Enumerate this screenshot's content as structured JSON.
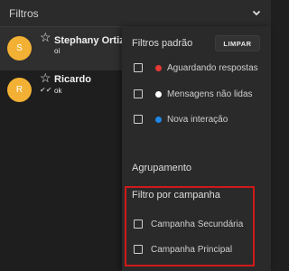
{
  "topbar": {
    "title": "Filtros"
  },
  "chats": [
    {
      "avatar": "S",
      "name": "Stephany Ortiz",
      "message": "oi"
    },
    {
      "avatar": "R",
      "name": "Ricardo",
      "message": "ok"
    }
  ],
  "panel": {
    "default_filters_title": "Filtros padrão",
    "clear_label": "LIMPAR",
    "options": [
      {
        "label": "Aguardando respostas",
        "color": "#e53935"
      },
      {
        "label": "Mensagens não lidas",
        "color": "#ffffff"
      },
      {
        "label": "Nova interação",
        "color": "#1e88e5"
      }
    ],
    "grouping_title": "Agrupamento",
    "campaign_title": "Filtro por campanha",
    "campaigns": [
      {
        "label": "Campanha Secundária"
      },
      {
        "label": "Campanha Principal"
      }
    ]
  },
  "colors": {
    "avatar": "#f2b134",
    "highlight": "#d01a1a"
  }
}
